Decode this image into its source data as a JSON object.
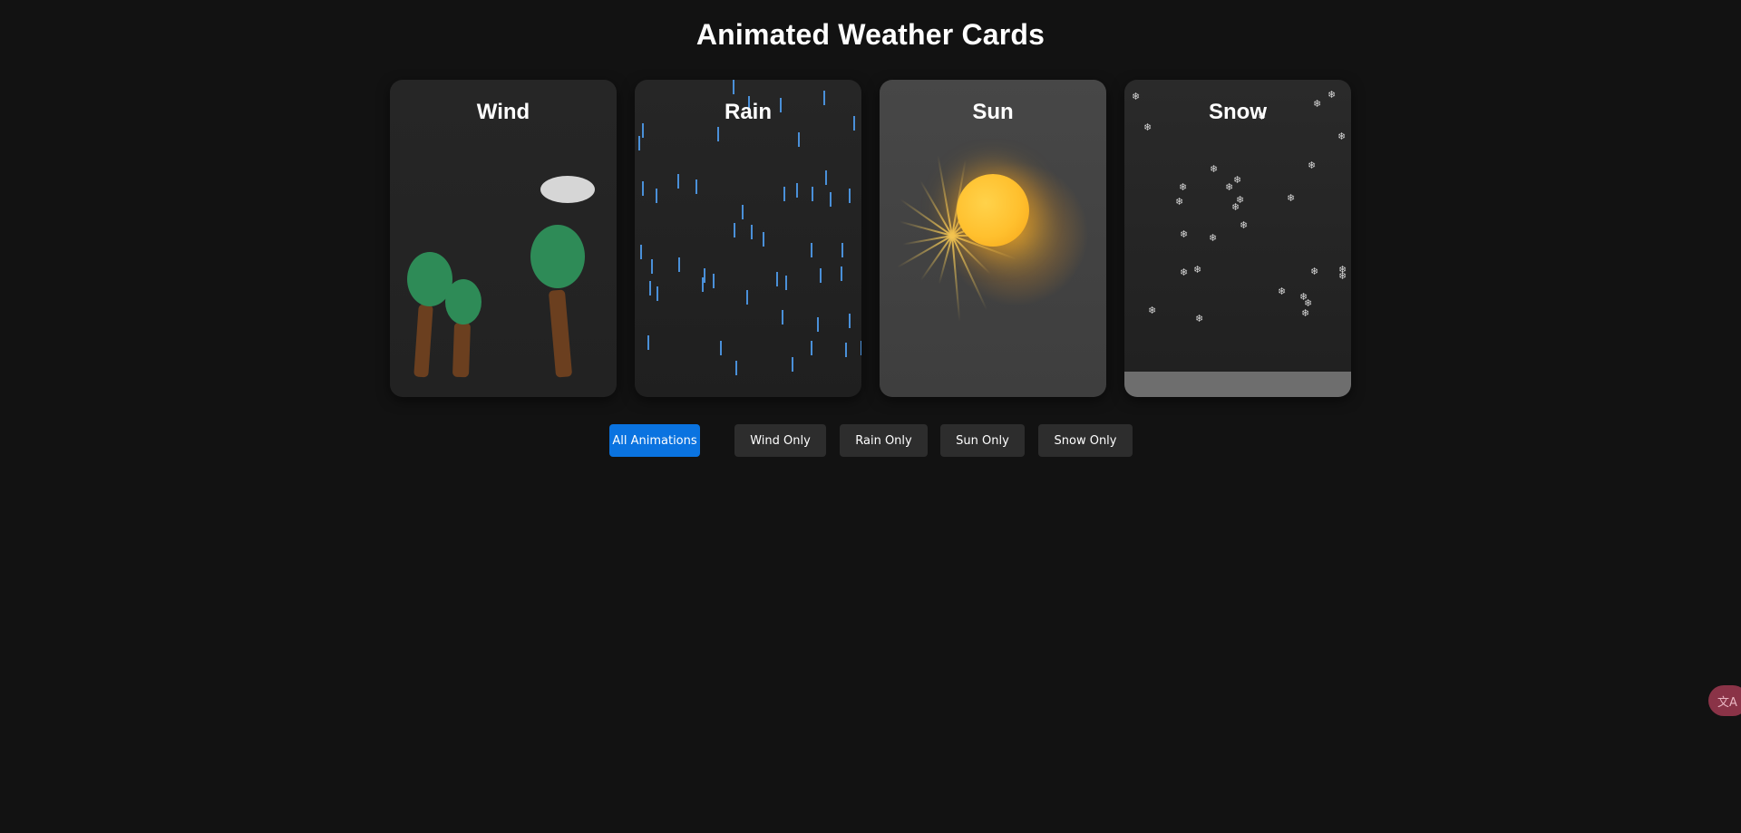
{
  "page": {
    "title": "Animated Weather Cards"
  },
  "cards": [
    {
      "title": "Wind",
      "icon": "wind-scene"
    },
    {
      "title": "Rain",
      "icon": "rain-scene"
    },
    {
      "title": "Sun",
      "icon": "sun-scene"
    },
    {
      "title": "Snow",
      "icon": "snow-scene"
    }
  ],
  "buttons": [
    {
      "label": "All Animations",
      "active": true
    },
    {
      "label": "Wind Only",
      "active": false
    },
    {
      "label": "Rain Only",
      "active": false
    },
    {
      "label": "Sun Only",
      "active": false
    },
    {
      "label": "Snow Only",
      "active": false
    }
  ],
  "snow": {
    "flake_glyph": "❄"
  },
  "translate_badge": {
    "label": "文A",
    "icon": "translate-icon"
  },
  "colors": {
    "background": "#121212",
    "accent": "#0a73e0",
    "rain": "#4a90d9",
    "tree": "#2e8b57",
    "trunk": "#6b3f1f",
    "sun": "#ffc02e"
  }
}
